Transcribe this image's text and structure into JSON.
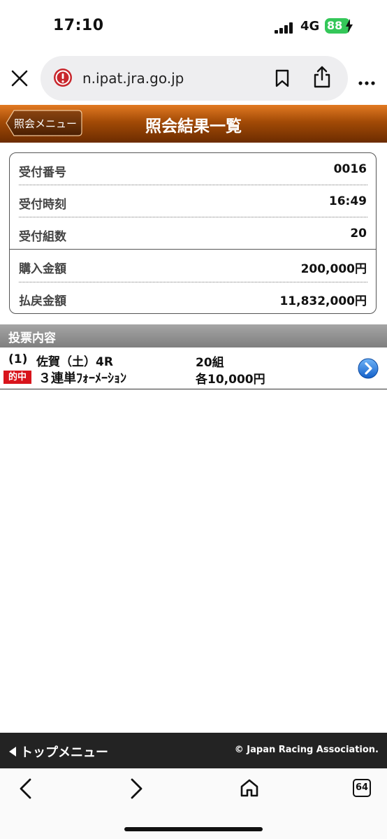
{
  "status_bar": {
    "time": "17:10",
    "network": "4G",
    "battery": "88",
    "battery_color": "#34c759"
  },
  "browser": {
    "url": "n.ipat.jra.go.jp",
    "icons": [
      "close-icon",
      "site-warning-icon",
      "bookmark-icon",
      "share-icon",
      "more-icon"
    ]
  },
  "header": {
    "back_label": "照会メニュー",
    "title": "照会結果一覧",
    "accent": "#a24a06"
  },
  "summary": {
    "rows": [
      {
        "label": "受付番号",
        "value": "0016"
      },
      {
        "label": "受付時刻",
        "value": "16:49"
      },
      {
        "label": "受付組数",
        "value": "20"
      },
      {
        "label": "購入金額",
        "value": "200,000円"
      },
      {
        "label": "払戻金額",
        "value": "11,832,000円"
      }
    ]
  },
  "section": {
    "title": "投票内容"
  },
  "vote": {
    "index": "(1)",
    "race": "佐賀（土）4R",
    "count": "20組",
    "badge": "的中",
    "badge_color": "#d8141c",
    "bet_type": "３連単ﾌｫｰﾒｰｼｮﾝ",
    "amount": "各10,000円"
  },
  "footer": {
    "menu_label": "トップメニュー",
    "copyright": "© Japan Racing Association."
  },
  "toolbar": {
    "tabs_count": "64"
  }
}
